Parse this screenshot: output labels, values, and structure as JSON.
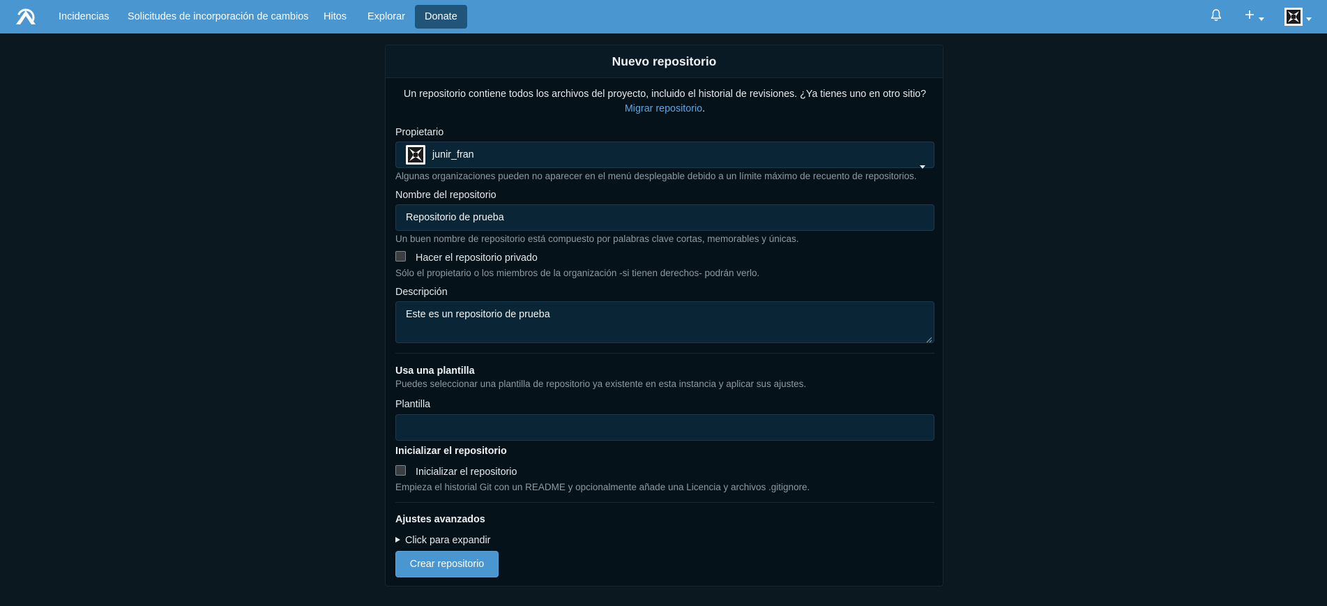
{
  "navbar": {
    "items": [
      {
        "label": "Incidencias"
      },
      {
        "label": "Solicitudes de incorporación de cambios"
      },
      {
        "label": "Hitos"
      },
      {
        "label": "Explorar"
      },
      {
        "label": "Donate"
      }
    ],
    "icons": [
      "forgejo-logo-icon",
      "bell-icon",
      "plus-icon",
      "user-avatar-icon"
    ],
    "accent_color": "#4a96d1"
  },
  "form": {
    "title": "Nuevo repositorio",
    "intro_text": "Un repositorio contiene todos los archivos del proyecto, incluido el historial de revisiones. ¿Ya tienes uno en otro sitio?",
    "migrate_link": "Migrar repositorio",
    "migrate_suffix": ".",
    "owner": {
      "label": "Propietario",
      "value": "junir_fran",
      "help": "Algunas organizaciones pueden no aparecer en el menú desplegable debido a un límite máximo de recuento de repositorios."
    },
    "repo_name": {
      "label": "Nombre del repositorio",
      "value": "Repositorio de prueba",
      "help": "Un buen nombre de repositorio está compuesto por palabras clave cortas, memorables y únicas."
    },
    "private": {
      "label": "Hacer el repositorio privado",
      "checked": false,
      "help": "Sólo el propietario o los miembros de la organización -si tienen derechos- podrán verlo."
    },
    "description": {
      "label": "Descripción",
      "value": "Este es un repositorio de prueba"
    },
    "template_section": {
      "title": "Usa una plantilla",
      "help": "Puedes seleccionar una plantilla de repositorio ya existente en esta instancia y aplicar sus ajustes.",
      "field_label": "Plantilla",
      "value": ""
    },
    "init_section": {
      "title": "Inicializar el repositorio",
      "checkbox_label": "Inicializar el repositorio",
      "checked": false,
      "help": "Empieza el historial Git con un README y opcionalmente añade una Licencia y archivos .gitignore."
    },
    "advanced": {
      "title": "Ajustes avanzados",
      "expander": "Click para expandir"
    },
    "submit_label": "Crear repositorio"
  }
}
